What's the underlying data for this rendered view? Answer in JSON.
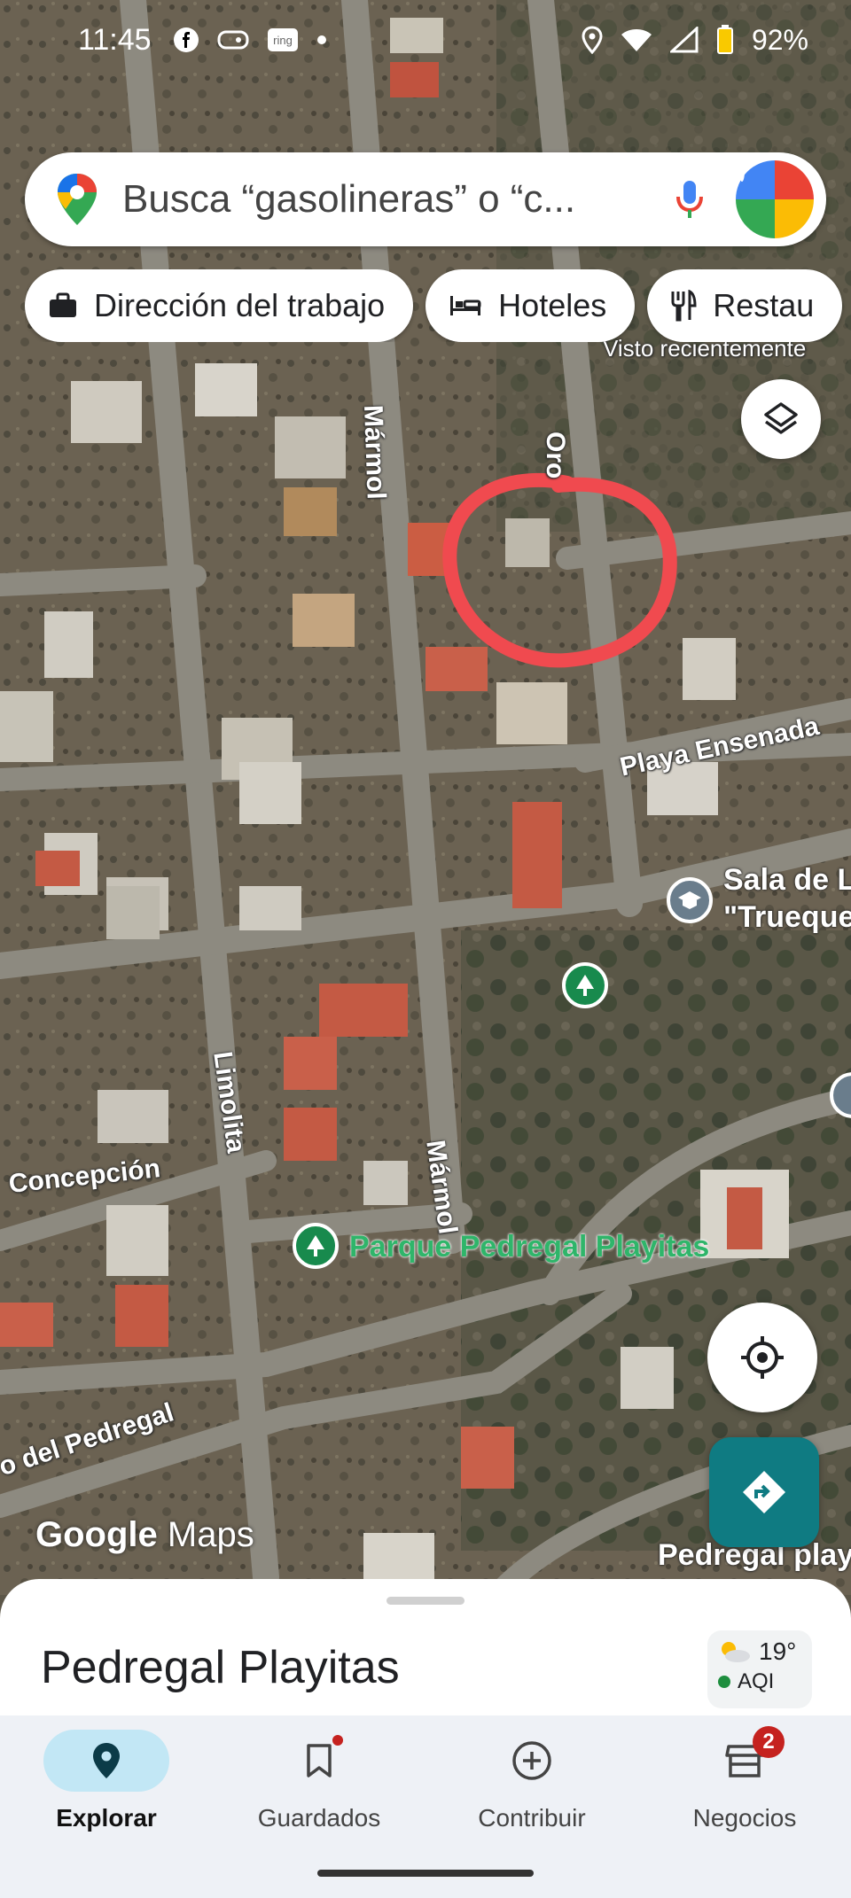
{
  "statusbar": {
    "time": "11:45",
    "battery": "92%"
  },
  "search": {
    "placeholder": "Busca “gasolineras” o “c..."
  },
  "chips": [
    {
      "label": "Dirección del trabajo",
      "icon": "briefcase-icon"
    },
    {
      "label": "Hoteles",
      "icon": "bed-icon"
    },
    {
      "label": "Restau",
      "icon": "restaurant-icon"
    }
  ],
  "map": {
    "recent_label": "Visto recientemente",
    "streets": {
      "oro": "Oro",
      "marmol_top": "Mármol",
      "marmol_bottom": "Mármol",
      "limolita": "Limolita",
      "playa_ensenada": "Playa Ensenada",
      "concepcion": "Concepción",
      "pedregal": "o del Pedregal"
    },
    "pois": {
      "sala": "Sala de L",
      "trueque": "\"Trueque",
      "parque": "Parque Pedregal Playitas",
      "pedregal_playi": "Pedregal playi"
    },
    "logo_google": "Google",
    "logo_maps": "Maps",
    "annotation_color": "#f04a4f"
  },
  "sheet": {
    "title": "Pedregal Playitas"
  },
  "weather": {
    "temp": "19°",
    "aqi": "AQI"
  },
  "nav": [
    {
      "label": "Explorar",
      "icon": "location-pin-icon",
      "active": true
    },
    {
      "label": "Guardados",
      "icon": "bookmark-icon"
    },
    {
      "label": "Contribuir",
      "icon": "add-circle-icon"
    },
    {
      "label": "Negocios",
      "icon": "store-icon",
      "badge": "2"
    }
  ],
  "colors": {
    "accent_teal": "#0f7b82",
    "active_nav": "#c2e7f5",
    "badge_red": "#c5221f"
  }
}
